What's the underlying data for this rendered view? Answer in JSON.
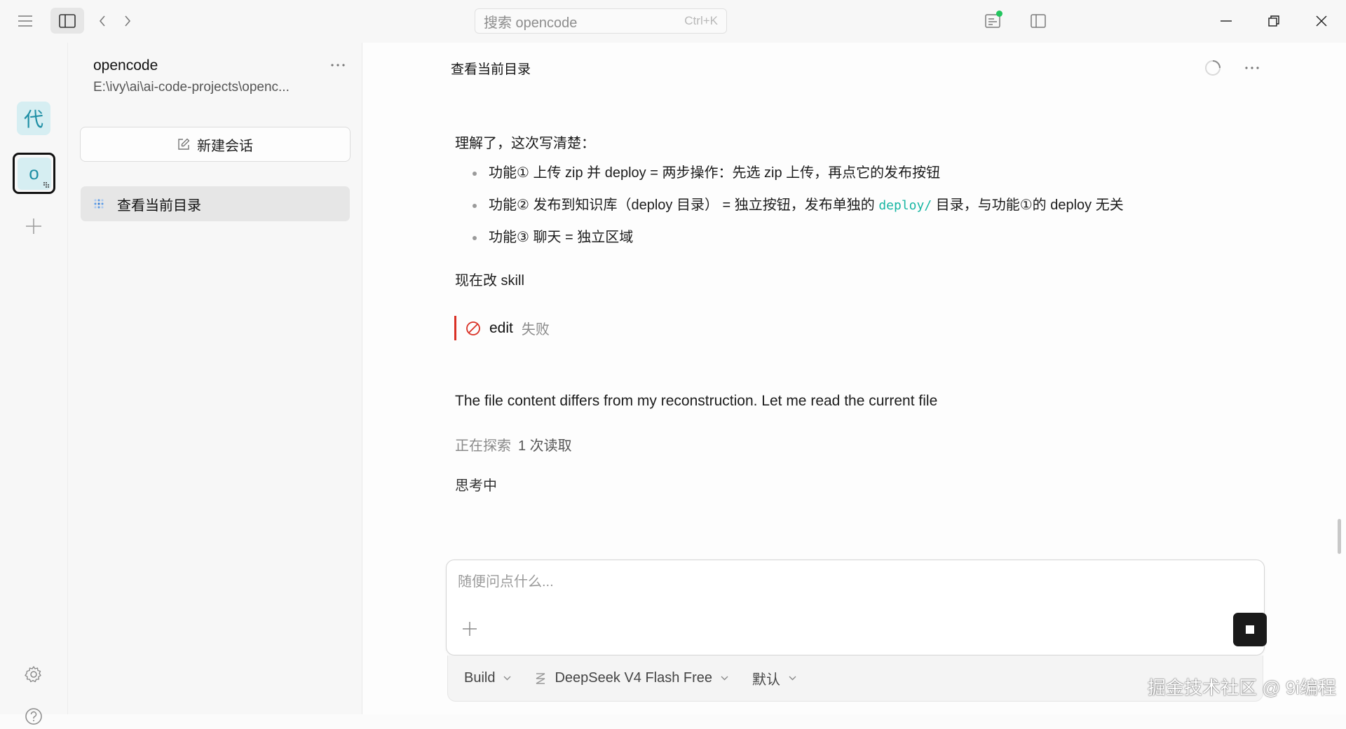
{
  "titlebar": {
    "search_placeholder": "搜索 opencode",
    "search_shortcut": "Ctrl+K"
  },
  "rail": {
    "projects": [
      {
        "initial": "代",
        "active": false
      },
      {
        "initial": "o",
        "active": true
      }
    ]
  },
  "session_panel": {
    "project_name": "opencode",
    "project_path": "E:\\ivy\\ai\\ai-code-projects\\openc...",
    "new_session_label": "新建会话",
    "sessions": [
      {
        "title": "查看当前目录",
        "active": true
      }
    ]
  },
  "main": {
    "title": "查看当前目录",
    "intro": "理解了，这次写清楚：",
    "bullets": {
      "b1": "功能① 上传 zip 并 deploy = 两步操作：先选 zip 上传，再点它的发布按钮",
      "b2_before": "功能② 发布到知识库（deploy 目录） = 独立按钮，发布单独的 ",
      "b2_code": "deploy/",
      "b2_after": " 目录，与功能①的 deploy 无关",
      "b3": "功能③ 聊天 = 独立区域"
    },
    "now_line": "现在改 skill",
    "tool_call": {
      "name": "edit",
      "status": "失败"
    },
    "english_line": "The file content differs from my reconstruction. Let me read the current file",
    "explore": {
      "label": "正在探索",
      "count": "1 次读取"
    },
    "thinking": "思考中"
  },
  "composer": {
    "placeholder": "随便问点什么...",
    "agent": "Build",
    "model": "DeepSeek V4 Flash Free",
    "variant": "默认"
  },
  "watermark": "掘金技术社区 @ 9i编程",
  "colors": {
    "accent_teal": "#17b6a3",
    "error_red": "#d93025",
    "status_green": "#22c55e",
    "project_tile_bg": "#d6eef2"
  }
}
